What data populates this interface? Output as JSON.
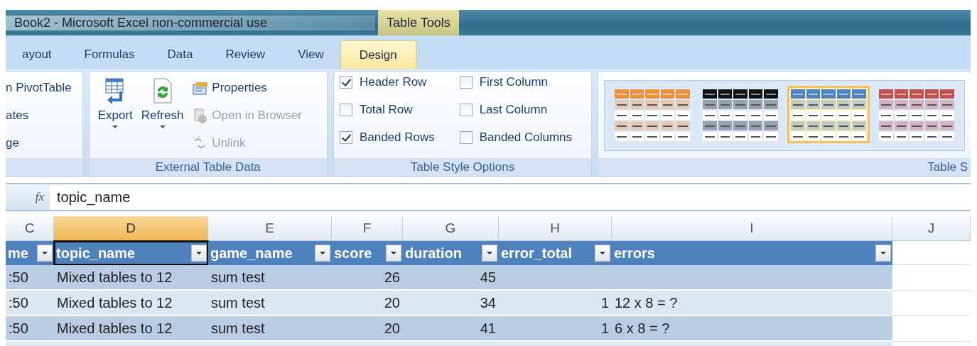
{
  "window": {
    "title": "Book2 - Microsoft Excel non-commercial use",
    "context_tab": "Table Tools"
  },
  "tabs": [
    {
      "label": "ayout",
      "selected": false
    },
    {
      "label": "Formulas",
      "selected": false
    },
    {
      "label": "Data",
      "selected": false
    },
    {
      "label": "Review",
      "selected": false
    },
    {
      "label": "View",
      "selected": false
    },
    {
      "label": "Design",
      "selected": true
    }
  ],
  "ribbon": {
    "first_group": {
      "items": [
        "n PivotTable",
        "ates",
        "ge"
      ]
    },
    "external_table_data": {
      "label": "External Table Data",
      "large_buttons": [
        {
          "label": "Export",
          "kind": "export"
        },
        {
          "label": "Refresh",
          "kind": "refresh"
        }
      ],
      "small_buttons": [
        {
          "label": "Properties",
          "kind": "properties",
          "disabled": false
        },
        {
          "label": "Open in Browser",
          "kind": "browser",
          "disabled": true
        },
        {
          "label": "Unlink",
          "kind": "unlink",
          "disabled": true
        }
      ]
    },
    "table_style_options": {
      "label": "Table Style Options",
      "options": [
        {
          "label": "Header Row",
          "checked": true
        },
        {
          "label": "Total Row",
          "checked": false
        },
        {
          "label": "Banded Rows",
          "checked": true
        },
        {
          "label": "First Column",
          "checked": false
        },
        {
          "label": "Last Column",
          "checked": false
        },
        {
          "label": "Banded Columns",
          "checked": false
        }
      ]
    },
    "table_styles": {
      "label": "Table S",
      "styles": [
        {
          "color": "#f0913a",
          "selected": false
        },
        {
          "color": "#111111",
          "selected": false
        },
        {
          "color": "#4f81bd",
          "selected": true
        },
        {
          "color": "#c0504d",
          "selected": false
        }
      ]
    }
  },
  "formula_bar": {
    "function_label": "fx",
    "value": "topic_name"
  },
  "sheet": {
    "columns": [
      {
        "letter": "C",
        "header": "me",
        "selected": false
      },
      {
        "letter": "D",
        "header": "topic_name",
        "selected": true
      },
      {
        "letter": "E",
        "header": "game_name",
        "selected": false
      },
      {
        "letter": "F",
        "header": "score",
        "selected": false
      },
      {
        "letter": "G",
        "header": "duration",
        "selected": false
      },
      {
        "letter": "H",
        "header": "error_total",
        "selected": false
      },
      {
        "letter": "I",
        "header": "errors",
        "selected": false
      },
      {
        "letter": "J",
        "selected": false
      }
    ],
    "rows": [
      [
        ":50",
        "Mixed tables to 12",
        "sum test",
        "26",
        "45",
        "",
        ""
      ],
      [
        ":50",
        "Mixed tables to 12",
        "sum test",
        "20",
        "34",
        "1",
        "12 x 8 = ?"
      ],
      [
        ":50",
        "Mixed tables to 12",
        "sum test",
        "20",
        "41",
        "1",
        "6 x 8 = ?"
      ]
    ]
  }
}
